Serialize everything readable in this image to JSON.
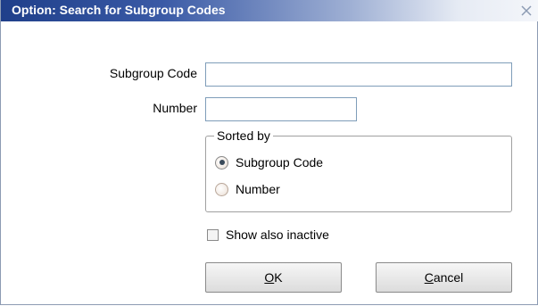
{
  "window": {
    "title": "Option: Search for Subgroup Codes"
  },
  "form": {
    "subgroup_code_label": "Subgroup Code",
    "subgroup_code_value": "",
    "number_label": "Number",
    "number_value": ""
  },
  "sorted_by": {
    "legend": "Sorted by",
    "options": [
      {
        "label": "Subgroup Code",
        "selected": true
      },
      {
        "label": "Number",
        "selected": false
      }
    ]
  },
  "show_inactive": {
    "label": "Show also inactive",
    "checked": false
  },
  "buttons": {
    "ok_access_key": "O",
    "ok_rest": "K",
    "cancel_access_key": "C",
    "cancel_rest": "ancel"
  },
  "icons": {
    "close": "close-icon"
  },
  "colors": {
    "title_gradient_start": "#1f3f8a",
    "title_text": "#ffffff",
    "input_border": "#7f9db9"
  }
}
